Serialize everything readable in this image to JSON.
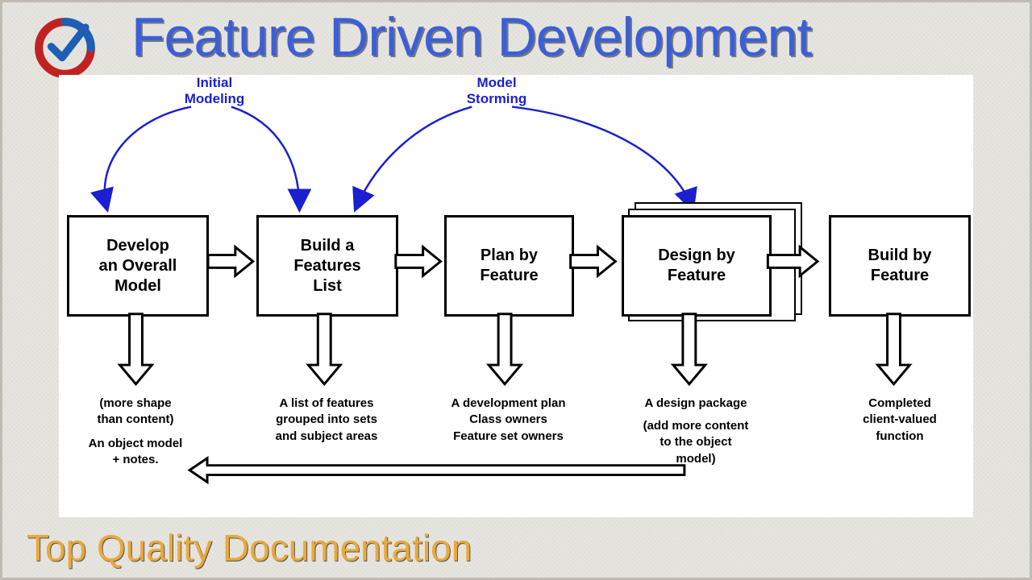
{
  "title": "Feature Driven Development",
  "subtitle": "Top Quality Documentation",
  "top_labels": {
    "initial_modeling": "Initial\nModeling",
    "model_storming": "Model\nStorming"
  },
  "steps": {
    "s1": "Develop\nan Overall\nModel",
    "s2": "Build a\nFeatures\nList",
    "s3": "Plan by\nFeature",
    "s4": "Design by\nFeature",
    "s5": "Build by\nFeature"
  },
  "outputs": {
    "o1a": "(more shape\nthan content)",
    "o1b": "An object model\n+ notes.",
    "o2": "A list of features\ngrouped into sets\nand subject areas",
    "o3": "A development plan\nClass owners\nFeature set owners",
    "o4a": "A design package",
    "o4b": "(add more content\nto the object\nmodel)",
    "o5": "Completed\nclient-valued\nfunction"
  }
}
